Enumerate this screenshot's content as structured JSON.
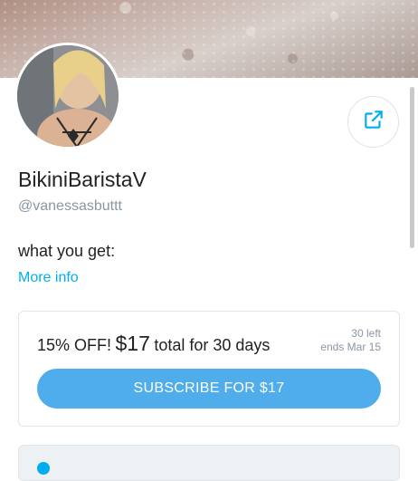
{
  "profile": {
    "display_name": "BikiniBaristaV",
    "username": "@vanessasbuttt",
    "about": "what you get:",
    "more_info_label": "More info"
  },
  "offer": {
    "discount_prefix": "15% OFF!",
    "price": "$17",
    "duration_suffix": "total for 30 days",
    "remaining": "30 left",
    "ends": "ends Mar 15",
    "subscribe_label": "SUBSCRIBE FOR $17"
  },
  "colors": {
    "accent": "#00aeef",
    "button": "#4fadeb",
    "muted_text": "#8a96a3"
  },
  "icons": {
    "share": "share-icon"
  }
}
